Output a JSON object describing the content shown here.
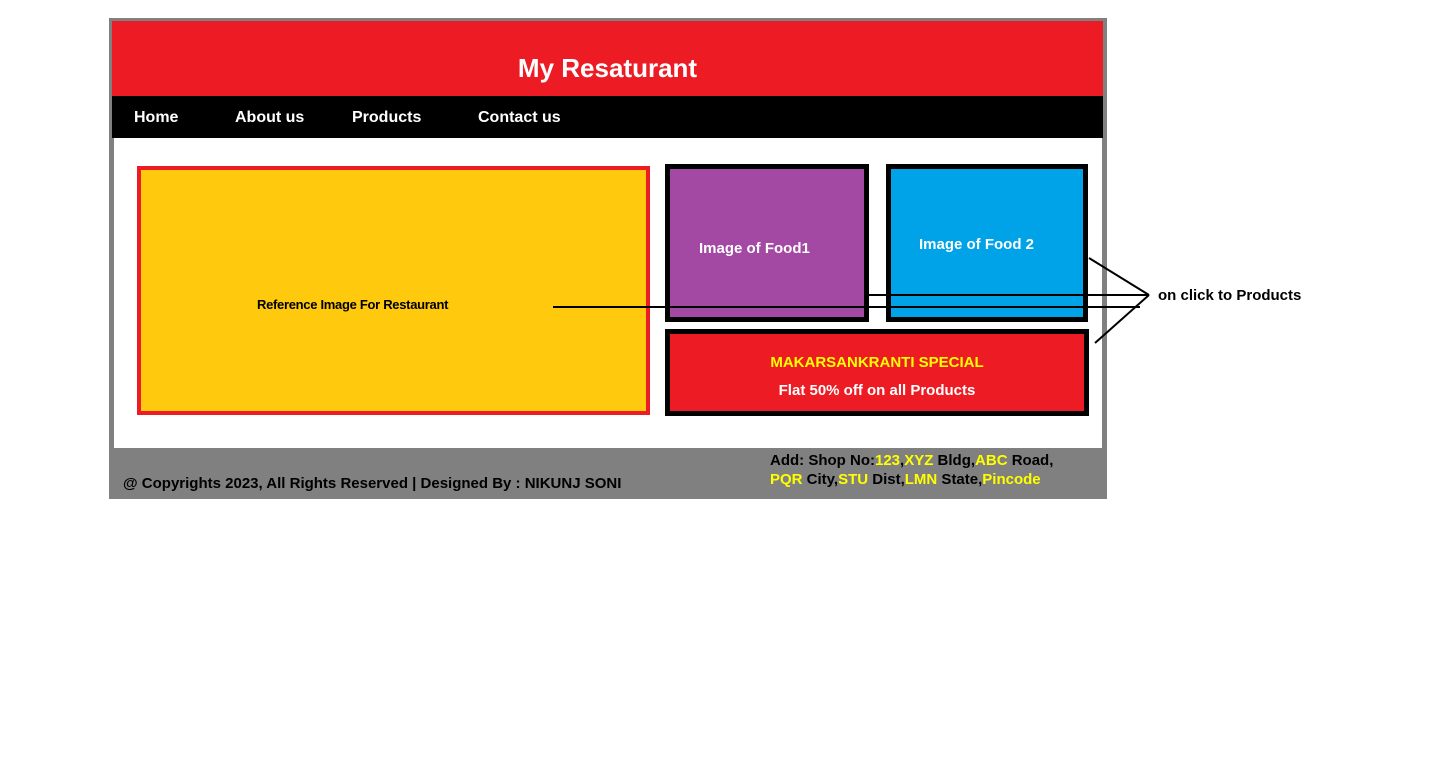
{
  "header": {
    "title": "My Resaturant"
  },
  "nav": {
    "items": [
      {
        "label": "Home"
      },
      {
        "label": "About us"
      },
      {
        "label": "Products"
      },
      {
        "label": "Contact us"
      }
    ]
  },
  "hero": {
    "label": "Reference Image For Restaurant"
  },
  "food": [
    {
      "label": "Image of Food1"
    },
    {
      "label": "Image of Food 2"
    }
  ],
  "offer": {
    "title": "MAKARSANKRANTI SPECIAL",
    "text": "Flat 50% off on all Products"
  },
  "footer": {
    "copyright": "@ Copyrights 2023, All Rights Reserved | Designed By : NIKUNJ SONI",
    "address": {
      "prefix": "Add: Shop No:",
      "shop_no": "123",
      "sep1": ",",
      "bldg_code": "XYZ",
      "bldg": " Bldg,",
      "road_code": "ABC",
      "road": " Road,",
      "city_code": "PQR",
      "city": " City,",
      "dist_code": "STU",
      "dist": " Dist,",
      "state_code": "LMN",
      "state": " State,",
      "pincode": "Pincode"
    }
  },
  "annotation": {
    "text": "on click to Products"
  },
  "colors": {
    "header_red": "#ed1c24",
    "nav_black": "#000000",
    "footer_gray": "#808080",
    "hero_yellow": "#ffc90e",
    "food1_purple": "#a349a4",
    "food2_blue": "#00a2e8",
    "highlight_yellow": "#ffff00"
  }
}
